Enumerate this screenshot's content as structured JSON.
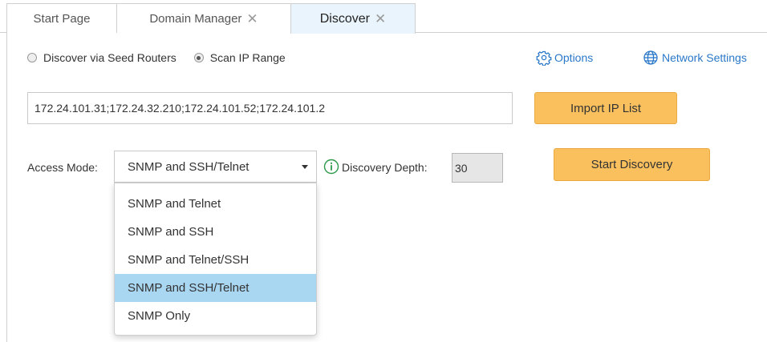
{
  "tabs": [
    {
      "label": "Start Page",
      "closable": false,
      "active": false
    },
    {
      "label": "Domain Manager",
      "closable": true,
      "active": false
    },
    {
      "label": "Discover",
      "closable": true,
      "active": true
    }
  ],
  "close_glyph": "✕",
  "discovery_method": {
    "options": [
      "Discover via Seed Routers",
      "Scan IP Range"
    ],
    "selected": "Scan IP Range"
  },
  "links": {
    "options": {
      "label": "Options",
      "icon": "gear-icon"
    },
    "network_settings": {
      "label": "Network Settings",
      "icon": "globe-icon"
    }
  },
  "ip_list": {
    "value": "172.24.101.31;172.24.32.210;172.24.101.52;172.24.101.2",
    "import_button": "Import IP List"
  },
  "access_mode": {
    "label": "Access Mode:",
    "value": "SNMP and SSH/Telnet",
    "options": [
      "SNMP and Telnet",
      "SNMP and SSH",
      "SNMP and Telnet/SSH",
      "SNMP and SSH/Telnet",
      "SNMP Only"
    ],
    "highlighted": "SNMP and SSH/Telnet"
  },
  "discovery_depth": {
    "label": "Discovery Depth:",
    "value": "30",
    "icon": "info-icon"
  },
  "start_button": "Start Discovery",
  "colors": {
    "accent_button": "#fbc05e",
    "link": "#2a78c8",
    "active_tab": "#eaf4fc",
    "highlight": "#a9d6f1",
    "info_icon": "#2d9a4a"
  }
}
